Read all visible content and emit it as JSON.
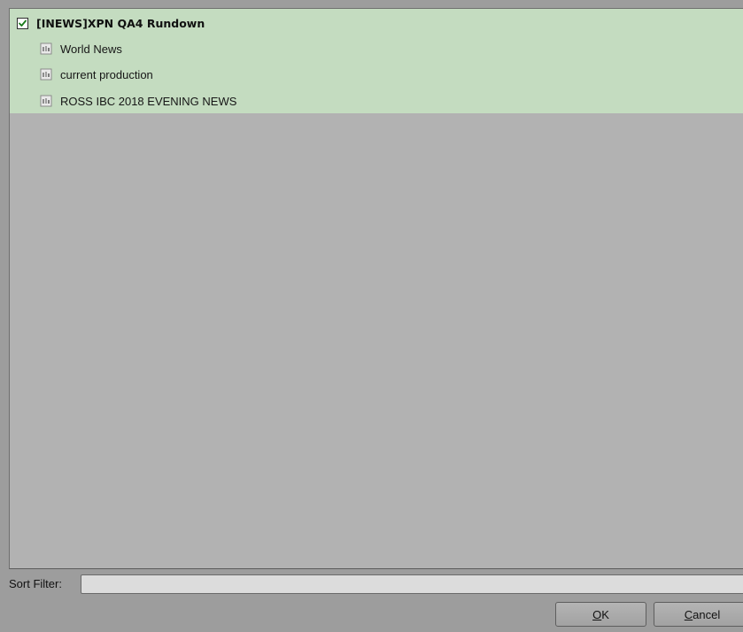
{
  "tree": {
    "root": {
      "label": "[INEWS]XPN QA4 Rundown",
      "checked": true,
      "icon": "checkbox-checked-icon"
    },
    "children": [
      {
        "label": "World News",
        "icon": "document-icon"
      },
      {
        "label": "current production",
        "icon": "document-icon"
      },
      {
        "label": "ROSS IBC 2018 EVENING NEWS",
        "icon": "document-icon"
      }
    ]
  },
  "sort_filter": {
    "label": "Sort Filter:",
    "value": ""
  },
  "buttons": {
    "ok": {
      "accel": "O",
      "rest": "K"
    },
    "cancel": {
      "accel": "C",
      "rest": "ancel"
    }
  },
  "colors": {
    "selection_highlight": "#c4dcc0",
    "panel_background": "#b2b2b2",
    "window_background": "#9d9d9d",
    "checkmark": "#1a7a1a"
  }
}
